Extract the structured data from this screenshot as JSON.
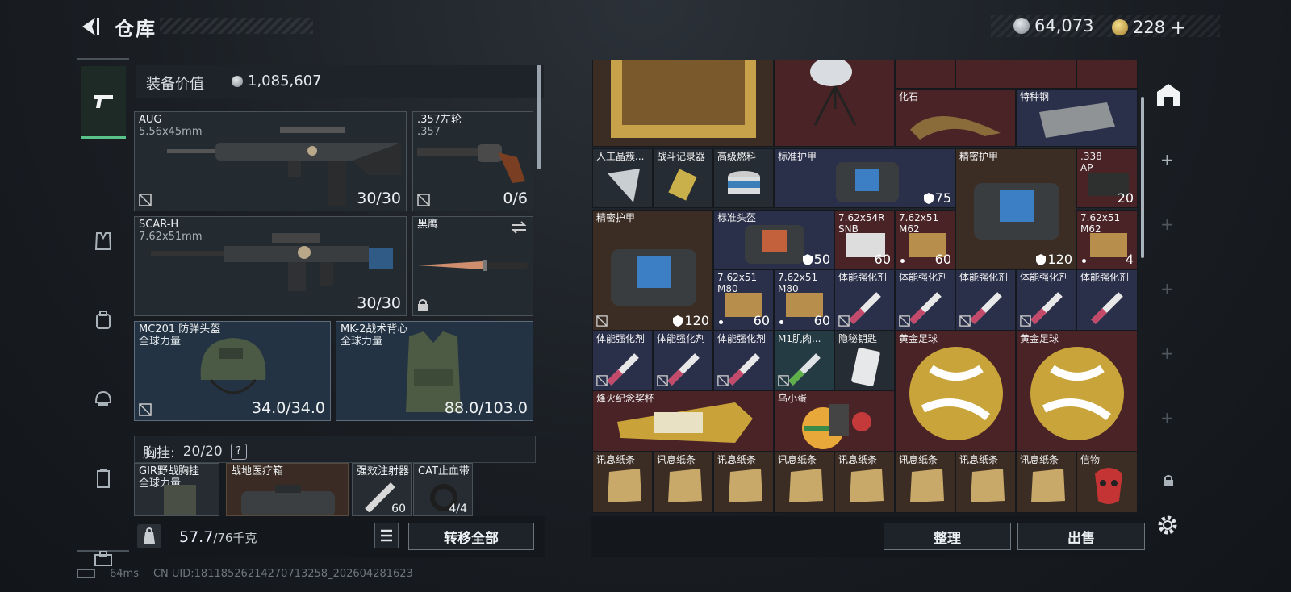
{
  "header": {
    "title": "仓库",
    "currency_silver": "64,073",
    "currency_gold": "228",
    "add_label": "+"
  },
  "equip_value": {
    "label": "装备价值",
    "value": "1,085,607"
  },
  "slots": {
    "primary1": {
      "name": "AUG",
      "caliber": "5.56x45mm",
      "ammo": "30/30"
    },
    "pistol": {
      "name": ".357左轮",
      "caliber": ".357",
      "ammo": "0/6"
    },
    "primary2": {
      "name": "SCAR-H",
      "caliber": "7.62x51mm",
      "ammo": "30/30"
    },
    "melee": {
      "name": "黑鹰"
    },
    "helmet": {
      "name": "MC201 防弹头盔",
      "brand": "全球力量",
      "durability": "34.0/34.0"
    },
    "armor": {
      "name": "MK-2战术背心",
      "brand": "全球力量",
      "durability": "88.0/103.0"
    }
  },
  "vest": {
    "label": "胸挂:",
    "count": "20/20",
    "help": "?"
  },
  "vest_items": [
    {
      "name": "GIR野战胸挂",
      "sub": "全球力量"
    },
    {
      "name": "战地医疗箱"
    },
    {
      "name": "强效注射器",
      "qty": "60"
    },
    {
      "name": "CAT止血带",
      "qty": "4/4"
    }
  ],
  "footer_left": {
    "weight": "57.7",
    "weight_max": "/76千克",
    "transfer_all": "转移全部"
  },
  "footer_right": {
    "sort": "整理",
    "sell": "出售"
  },
  "grid": {
    "row1": [
      {
        "name": "化石"
      },
      {
        "name": "特种钢"
      }
    ],
    "row2": [
      {
        "name": "人工晶簇..."
      },
      {
        "name": "战斗记录器"
      },
      {
        "name": "高级燃料"
      },
      {
        "name": "标准护甲",
        "armor": "75"
      },
      {
        "name": "精密护甲"
      },
      {
        "name": ".338 AP",
        "qty": "20"
      }
    ],
    "row3": [
      {
        "name": "精密护甲",
        "armor": "120"
      },
      {
        "name": "标准头盔",
        "armor": "50"
      },
      {
        "name": "7.62x54R SNB",
        "qty": "60"
      },
      {
        "name": "7.62x51 M62",
        "qty": "60"
      },
      {
        "name": "精密护甲",
        "armor": "120"
      },
      {
        "name": "7.62x51 M62",
        "qty": "4"
      }
    ],
    "row3b": [
      {
        "name": "7.62x51 M80",
        "qty": "60"
      },
      {
        "name": "7.62x51 M80",
        "qty": "60"
      }
    ],
    "row3c": [
      "体能强化剂",
      "体能强化剂",
      "体能强化剂",
      "体能强化剂",
      "体能强化剂"
    ],
    "row4": [
      "体能强化剂",
      "体能强化剂",
      "体能强化剂",
      "M1肌肉...",
      "隐秘钥匙",
      "黄金足球",
      "黄金足球"
    ],
    "row5": [
      "烽火纪念奖杯",
      "乌小蛋"
    ],
    "row6": [
      "讯息纸条",
      "讯息纸条",
      "讯息纸条",
      "讯息纸条",
      "讯息纸条",
      "讯息纸条",
      "讯息纸条",
      "讯息纸条",
      "信物"
    ]
  },
  "status_bar": {
    "ping": "64ms",
    "uid": "CN UID:18118526214270713258_202604281623"
  }
}
